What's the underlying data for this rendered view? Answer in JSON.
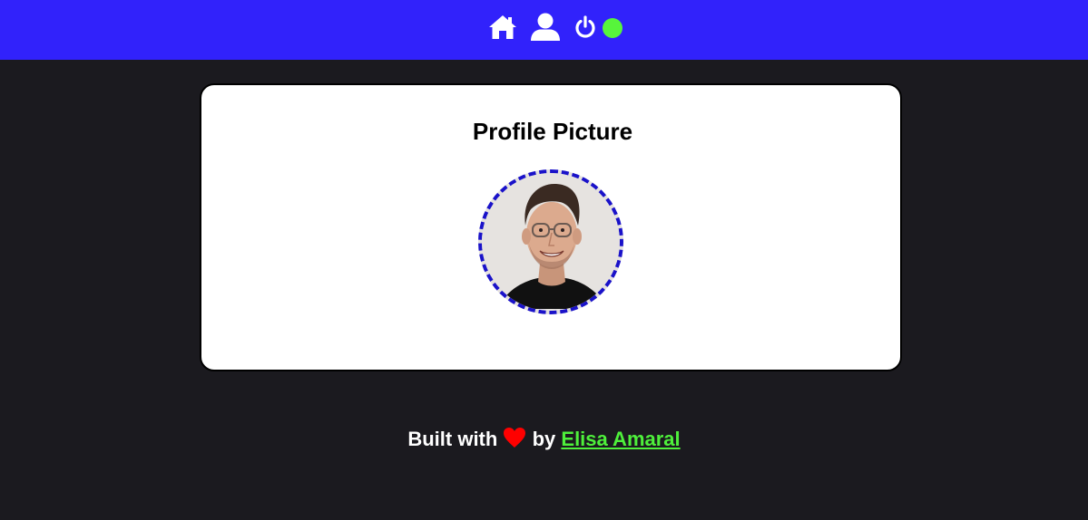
{
  "nav": {
    "icons": [
      "home-icon",
      "user-icon",
      "power-icon"
    ],
    "status": "online"
  },
  "card": {
    "title": "Profile Picture",
    "avatar_alt": "Profile picture"
  },
  "footer": {
    "prefix": "Built with",
    "heart_icon": "heart-icon",
    "by": "by",
    "author": "Elisa Amaral"
  },
  "colors": {
    "topbar": "#3122fb",
    "background": "#1b1a1f",
    "status_online": "#57f53b",
    "avatar_border": "#1a12c9",
    "link": "#4ef03b",
    "heart": "#ff0000"
  }
}
